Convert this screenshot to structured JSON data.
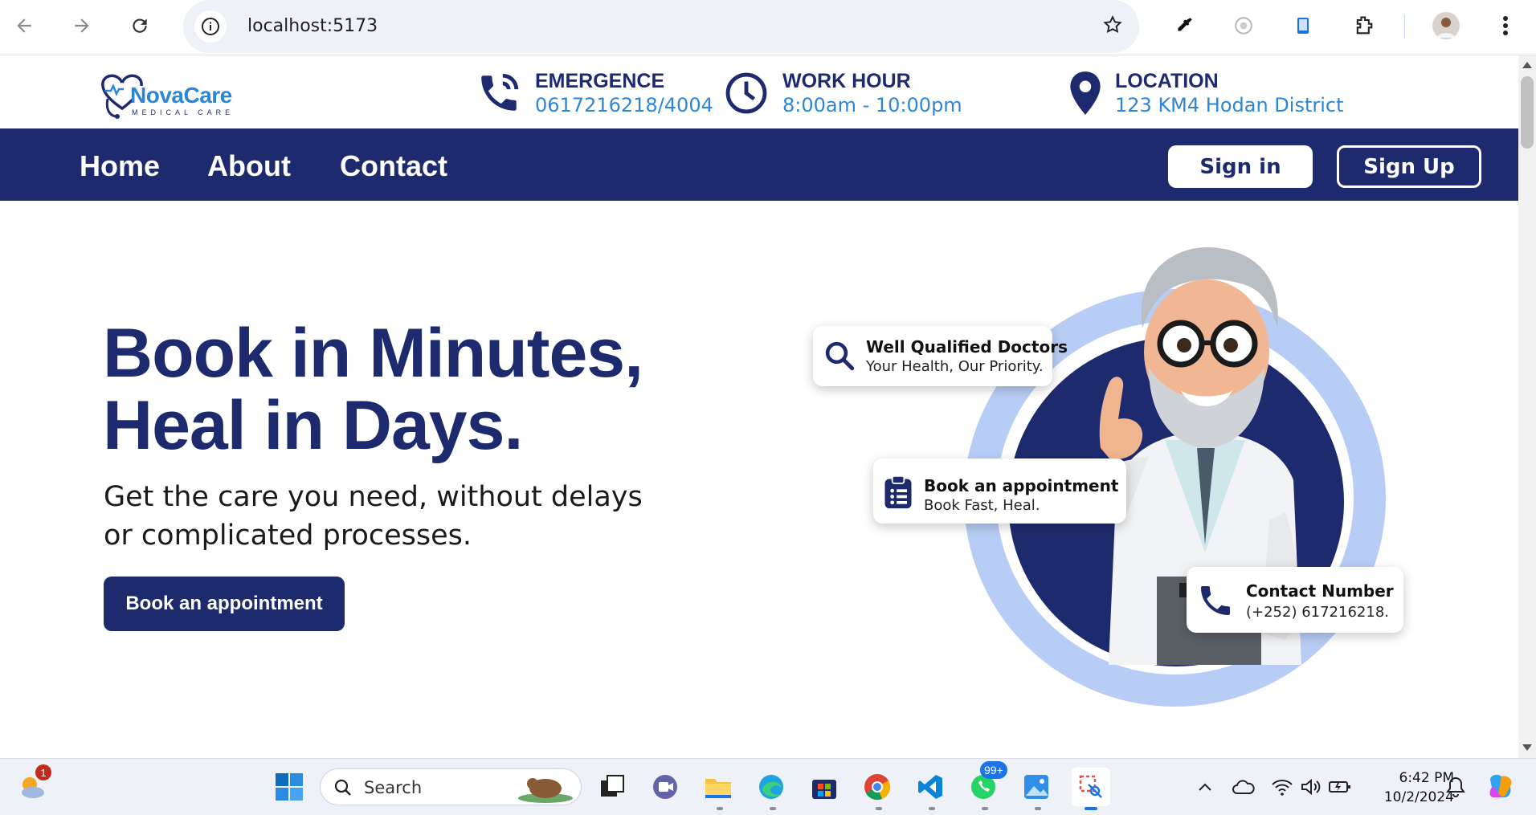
{
  "browser": {
    "url": "localhost:5173"
  },
  "site": {
    "logo": {
      "name": "NovaCare",
      "tagline": "MEDICAL CARE"
    },
    "info": {
      "emergency": {
        "title": "EMERGENCE",
        "value": "0617216218/4004",
        "icon": "phone-icon"
      },
      "work_hour": {
        "title": "WORK HOUR",
        "value": "8:00am - 10:00pm",
        "icon": "clock-icon"
      },
      "location": {
        "title": "LOCATION",
        "value": "123 KM4 Hodan District",
        "icon": "location-pin-icon"
      }
    },
    "nav": {
      "links": [
        "Home",
        "About",
        "Contact"
      ],
      "signin": "Sign in",
      "signup": "Sign Up"
    },
    "hero": {
      "title_line1": "Book in Minutes,",
      "title_line2": "Heal in Days.",
      "subtitle": "Get the care you need, without delays or complicated processes.",
      "button": "Book an appointment"
    },
    "cards": [
      {
        "title": "Well Qualified Doctors",
        "sub": "Your Health, Our Priority.",
        "icon": "search-icon"
      },
      {
        "title": "Book an appointment",
        "sub": "Book Fast, Heal.",
        "icon": "clipboard-icon"
      },
      {
        "title": "Contact Number",
        "sub": "(+252) 617216218.",
        "icon": "phone-icon"
      }
    ],
    "colors": {
      "primary": "#1e2a6e",
      "accent": "#2b87d6",
      "ring": "#b8cdf5"
    }
  },
  "taskbar": {
    "search_placeholder": "Search",
    "whatsapp_badge": "99+",
    "weather_badge": "1",
    "time": "6:42 PM",
    "date": "10/2/2024"
  }
}
